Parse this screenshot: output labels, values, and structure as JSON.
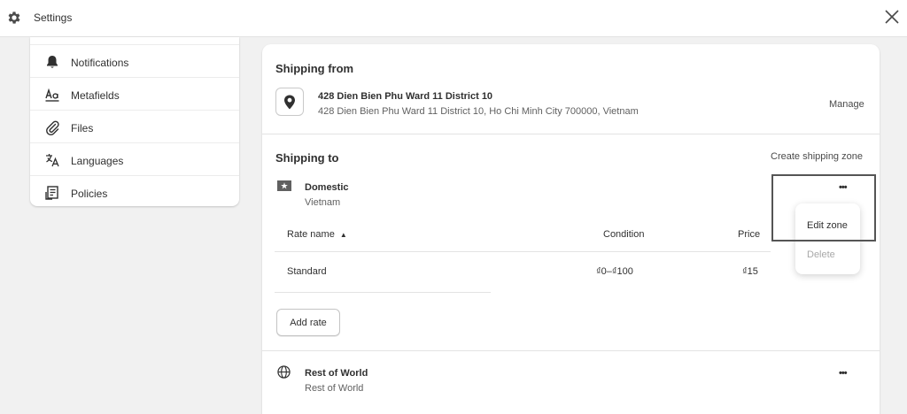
{
  "topbar": {
    "title": "Settings",
    "icons": {
      "settings": "gear-icon",
      "close": "close-icon"
    }
  },
  "sidebar": {
    "items": [
      {
        "label": "Notifications",
        "icon": "bell-icon"
      },
      {
        "label": "Metafields",
        "icon": "metafields-icon"
      },
      {
        "label": "Files",
        "icon": "paperclip-icon"
      },
      {
        "label": "Languages",
        "icon": "translate-icon"
      },
      {
        "label": "Policies",
        "icon": "policy-document-icon"
      }
    ]
  },
  "shipping_from": {
    "heading": "Shipping from",
    "address_line1": "428 Dien Bien Phu Ward 11 District 10",
    "address_line2": "428 Dien Bien Phu Ward 11 District 10, Ho Chi Minh City 700000, Vietnam",
    "manage_label": "Manage"
  },
  "shipping_to": {
    "heading": "Shipping to",
    "create_zone_label": "Create shipping zone",
    "zones": [
      {
        "name": "Domestic",
        "country": "Vietnam",
        "columns": {
          "rate_name": "Rate name",
          "condition": "Condition",
          "price": "Price"
        },
        "sort_indicator": "▲",
        "rates": [
          {
            "name": "Standard",
            "condition": "₫0–₫100",
            "price": "₫15"
          }
        ],
        "add_rate_label": "Add rate",
        "more_label": "•••"
      },
      {
        "name": "Rest of World",
        "country": "Rest of World",
        "more_label": "•••"
      }
    ]
  },
  "zone_menu": {
    "items": [
      {
        "label": "Edit zone",
        "enabled": true
      },
      {
        "label": "Delete",
        "enabled": false
      }
    ]
  },
  "colors": {
    "background": "#f1f1f1",
    "surface": "#ffffff",
    "text": "#303030",
    "muted_text": "#616161",
    "disabled_text": "#a8a8a8",
    "border": "#e3e3e3",
    "highlight_box": "#555555"
  }
}
